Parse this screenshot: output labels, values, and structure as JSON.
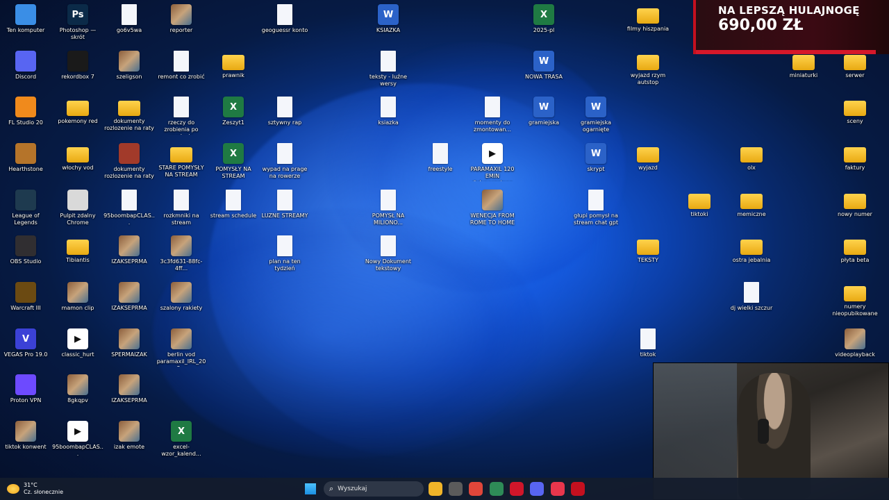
{
  "desktop_icons": [
    {
      "label": "Ten komputer",
      "type": "app",
      "color": "#3a8ee6"
    },
    {
      "label": "Photoshop — skrót",
      "type": "app",
      "color": "#0b2a48",
      "mark": "Ps"
    },
    {
      "label": "go6v5wa",
      "type": "doc"
    },
    {
      "label": "reporter",
      "type": "pic"
    },
    {
      "label": "geoguessr konto",
      "type": "doc"
    },
    {
      "label": "KSIAZKA",
      "type": "word",
      "mark": "W"
    },
    {
      "label": "2025-pl",
      "type": "excel",
      "mark": "X"
    },
    {
      "label": "filmy hiszpania",
      "type": "folder"
    },
    {
      "label": "Discord",
      "type": "app",
      "color": "#5865f2"
    },
    {
      "label": "rekordbox 7",
      "type": "app",
      "color": "#1a1a1a"
    },
    {
      "label": "szeligson",
      "type": "pic"
    },
    {
      "label": "remont co zrobić",
      "type": "doc"
    },
    {
      "label": "prawnik",
      "type": "folder"
    },
    {
      "label": "teksty - luźne wersy",
      "type": "doc"
    },
    {
      "label": "NOWA TRASA",
      "type": "word",
      "mark": "W"
    },
    {
      "label": "wyjazd rzym autstop",
      "type": "folder"
    },
    {
      "label": "miniaturki",
      "type": "folder"
    },
    {
      "label": "serwer",
      "type": "folder"
    },
    {
      "label": "FL Studio 20",
      "type": "app",
      "color": "#f08a1c"
    },
    {
      "label": "pokemony red",
      "type": "folder"
    },
    {
      "label": "dokumenty rozlozenie na raty",
      "type": "folder"
    },
    {
      "label": "rzeczy do zrobienia po wypłacie",
      "type": "doc"
    },
    {
      "label": "Zeszyt1",
      "type": "excel",
      "mark": "X"
    },
    {
      "label": "sztywny rap",
      "type": "doc"
    },
    {
      "label": "ksiazka",
      "type": "doc"
    },
    {
      "label": "momenty do zmontowan...",
      "type": "doc"
    },
    {
      "label": "gramiejska",
      "type": "word",
      "mark": "W"
    },
    {
      "label": "gramiejska ogarnięte",
      "type": "word",
      "mark": "W"
    },
    {
      "label": "sceny",
      "type": "folder"
    },
    {
      "label": "Hearthstone",
      "type": "app",
      "color": "#b5742a"
    },
    {
      "label": "włochy vod",
      "type": "folder"
    },
    {
      "label": "dokumenty rozlozenie na raty",
      "type": "app",
      "color": "#a23a2a"
    },
    {
      "label": "STARE POMYSŁY NA STREAM",
      "type": "folder"
    },
    {
      "label": "POMYSŁY NA STREAM",
      "type": "excel",
      "mark": "X"
    },
    {
      "label": "wypad na prage na rowerze",
      "type": "doc"
    },
    {
      "label": "freestyle",
      "type": "doc"
    },
    {
      "label": "PARAMAXIL 120 EMIN @dvpaszatana",
      "type": "media",
      "mark": "▶"
    },
    {
      "label": "skrypt",
      "type": "word",
      "mark": "W"
    },
    {
      "label": "wyjazd",
      "type": "folder"
    },
    {
      "label": "olx",
      "type": "folder"
    },
    {
      "label": "faktury",
      "type": "folder"
    },
    {
      "label": "League of Legends",
      "type": "app",
      "color": "#1e3a4f"
    },
    {
      "label": "Pulpit zdalny Chrome",
      "type": "app",
      "color": "#d9d9d9"
    },
    {
      "label": "95boombapCLAS...",
      "type": "doc"
    },
    {
      "label": "rozkmniki na stream",
      "type": "doc"
    },
    {
      "label": "stream schedule",
      "type": "doc"
    },
    {
      "label": "LUZNE STREAMY",
      "type": "doc"
    },
    {
      "label": "POMYSŁ NA MILIONO...",
      "type": "doc"
    },
    {
      "label": "WENECJA FROM ROME TO HOME ...",
      "type": "pic"
    },
    {
      "label": "głupi pomysł na stream chat gpt",
      "type": "doc"
    },
    {
      "label": "tiktoki",
      "type": "folder"
    },
    {
      "label": "memiczne",
      "type": "folder"
    },
    {
      "label": "nowy numer",
      "type": "folder"
    },
    {
      "label": "OBS Studio",
      "type": "app",
      "color": "#302e31"
    },
    {
      "label": "Tibiantis",
      "type": "folder"
    },
    {
      "label": "IZAKSEPRMA",
      "type": "pic"
    },
    {
      "label": "3c3fd631-88fc-4ff...",
      "type": "pic"
    },
    {
      "label": "plan na ten tydzień",
      "type": "doc"
    },
    {
      "label": "Nowy Dokument tekstowy",
      "type": "doc"
    },
    {
      "label": "TEKSTY",
      "type": "folder"
    },
    {
      "label": "ostra jebalnia",
      "type": "folder"
    },
    {
      "label": "płyta beta",
      "type": "folder"
    },
    {
      "label": "Warcraft III",
      "type": "app",
      "color": "#6b4a12"
    },
    {
      "label": "mamon clip",
      "type": "pic"
    },
    {
      "label": "IZAKSEPRMA",
      "type": "pic"
    },
    {
      "label": "szalony rakiety",
      "type": "pic"
    },
    {
      "label": "dj wielki szczur",
      "type": "doc"
    },
    {
      "label": "numery nieopubikowane",
      "type": "folder"
    },
    {
      "label": "VEGAS Pro 19.0",
      "type": "app",
      "color": "#3b41d6",
      "mark": "V"
    },
    {
      "label": "classic_hurt",
      "type": "media",
      "mark": "▶"
    },
    {
      "label": "SPERMAIZAK",
      "type": "pic"
    },
    {
      "label": "berlin vod paramaxil_IRL_202...",
      "type": "pic"
    },
    {
      "label": "tiktok",
      "type": "doc"
    },
    {
      "label": "videoplayback",
      "type": "pic"
    },
    {
      "label": "Proton VPN",
      "type": "app",
      "color": "#6d4aff"
    },
    {
      "label": "8gkqpv",
      "type": "pic"
    },
    {
      "label": "IZAKSEPRMA",
      "type": "pic"
    },
    {
      "label": "tiktok konwent",
      "type": "pic"
    },
    {
      "label": "95boombapCLAS...",
      "type": "media",
      "mark": "▶"
    },
    {
      "label": "izak emote",
      "type": "pic"
    },
    {
      "label": "excel-wzor_kalend...",
      "type": "excel",
      "mark": "X"
    }
  ],
  "donation": {
    "title": "NA LEPSZĄ HULAJNOGĘ",
    "amount": "690,00 ZŁ",
    "progress": 0.92
  },
  "taskbar": {
    "weather_temp": "31°C",
    "weather_desc": "Cz. słonecznie",
    "search_placeholder": "Wyszukaj",
    "apps": [
      {
        "name": "file-explorer-icon",
        "color": "#f0b429"
      },
      {
        "name": "settings-app-icon",
        "color": "#5b5b5b"
      },
      {
        "name": "chrome-icon",
        "color": "#e0463a"
      },
      {
        "name": "chrome-dev-icon",
        "color": "#2e8b57"
      },
      {
        "name": "opera-icon",
        "color": "#d0162a"
      },
      {
        "name": "discord-icon",
        "color": "#5865f2"
      },
      {
        "name": "red-app-icon",
        "color": "#e8364c"
      },
      {
        "name": "app-icon",
        "color": "#c4101f"
      }
    ]
  }
}
